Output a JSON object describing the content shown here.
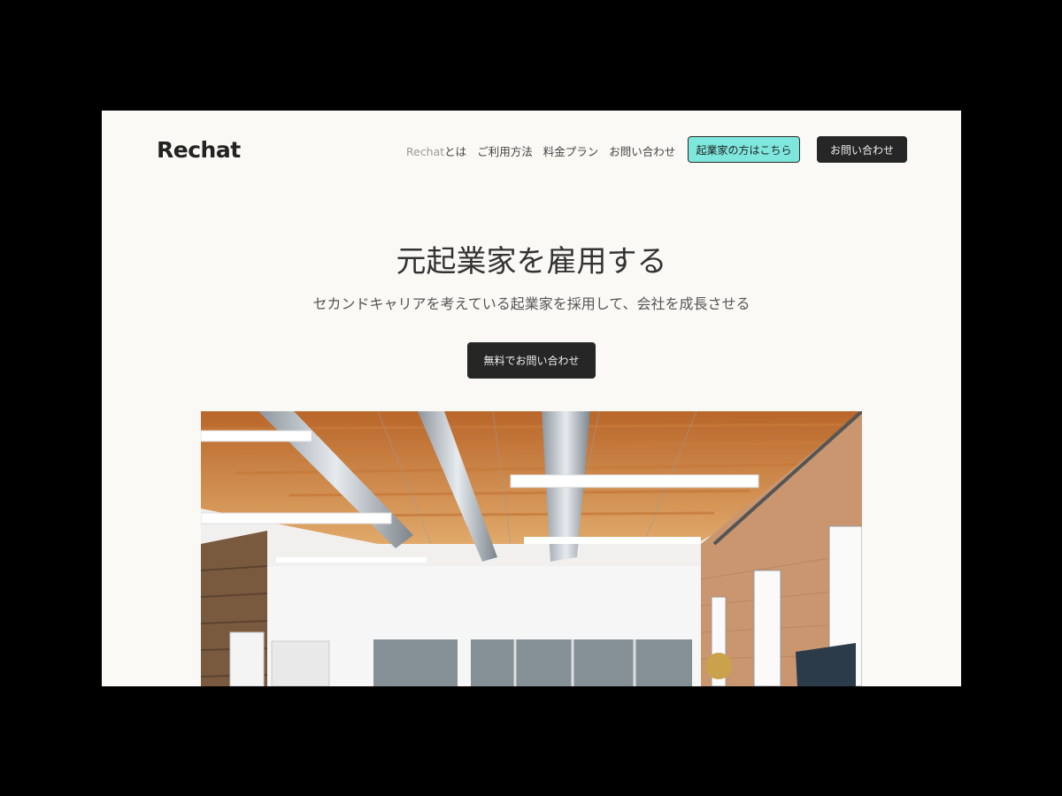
{
  "logo": "Rechat",
  "nav": {
    "about_brand": "Rechat",
    "about_suffix": "とは",
    "usage": "ご利用方法",
    "pricing": "料金プラン",
    "contact": "お問い合わせ"
  },
  "buttons": {
    "entrepreneur": "起業家の方はこちら",
    "contact": "お問い合わせ"
  },
  "hero": {
    "title": "元起業家を雇用する",
    "subtitle": "セカンドキャリアを考えている起業家を採用して、会社を成長させる",
    "cta": "無料でお問い合わせ"
  },
  "colors": {
    "accent": "#7ee7dd",
    "dark": "#262626",
    "background": "#faf9f5"
  },
  "image": {
    "description_icon": "office-photo"
  }
}
